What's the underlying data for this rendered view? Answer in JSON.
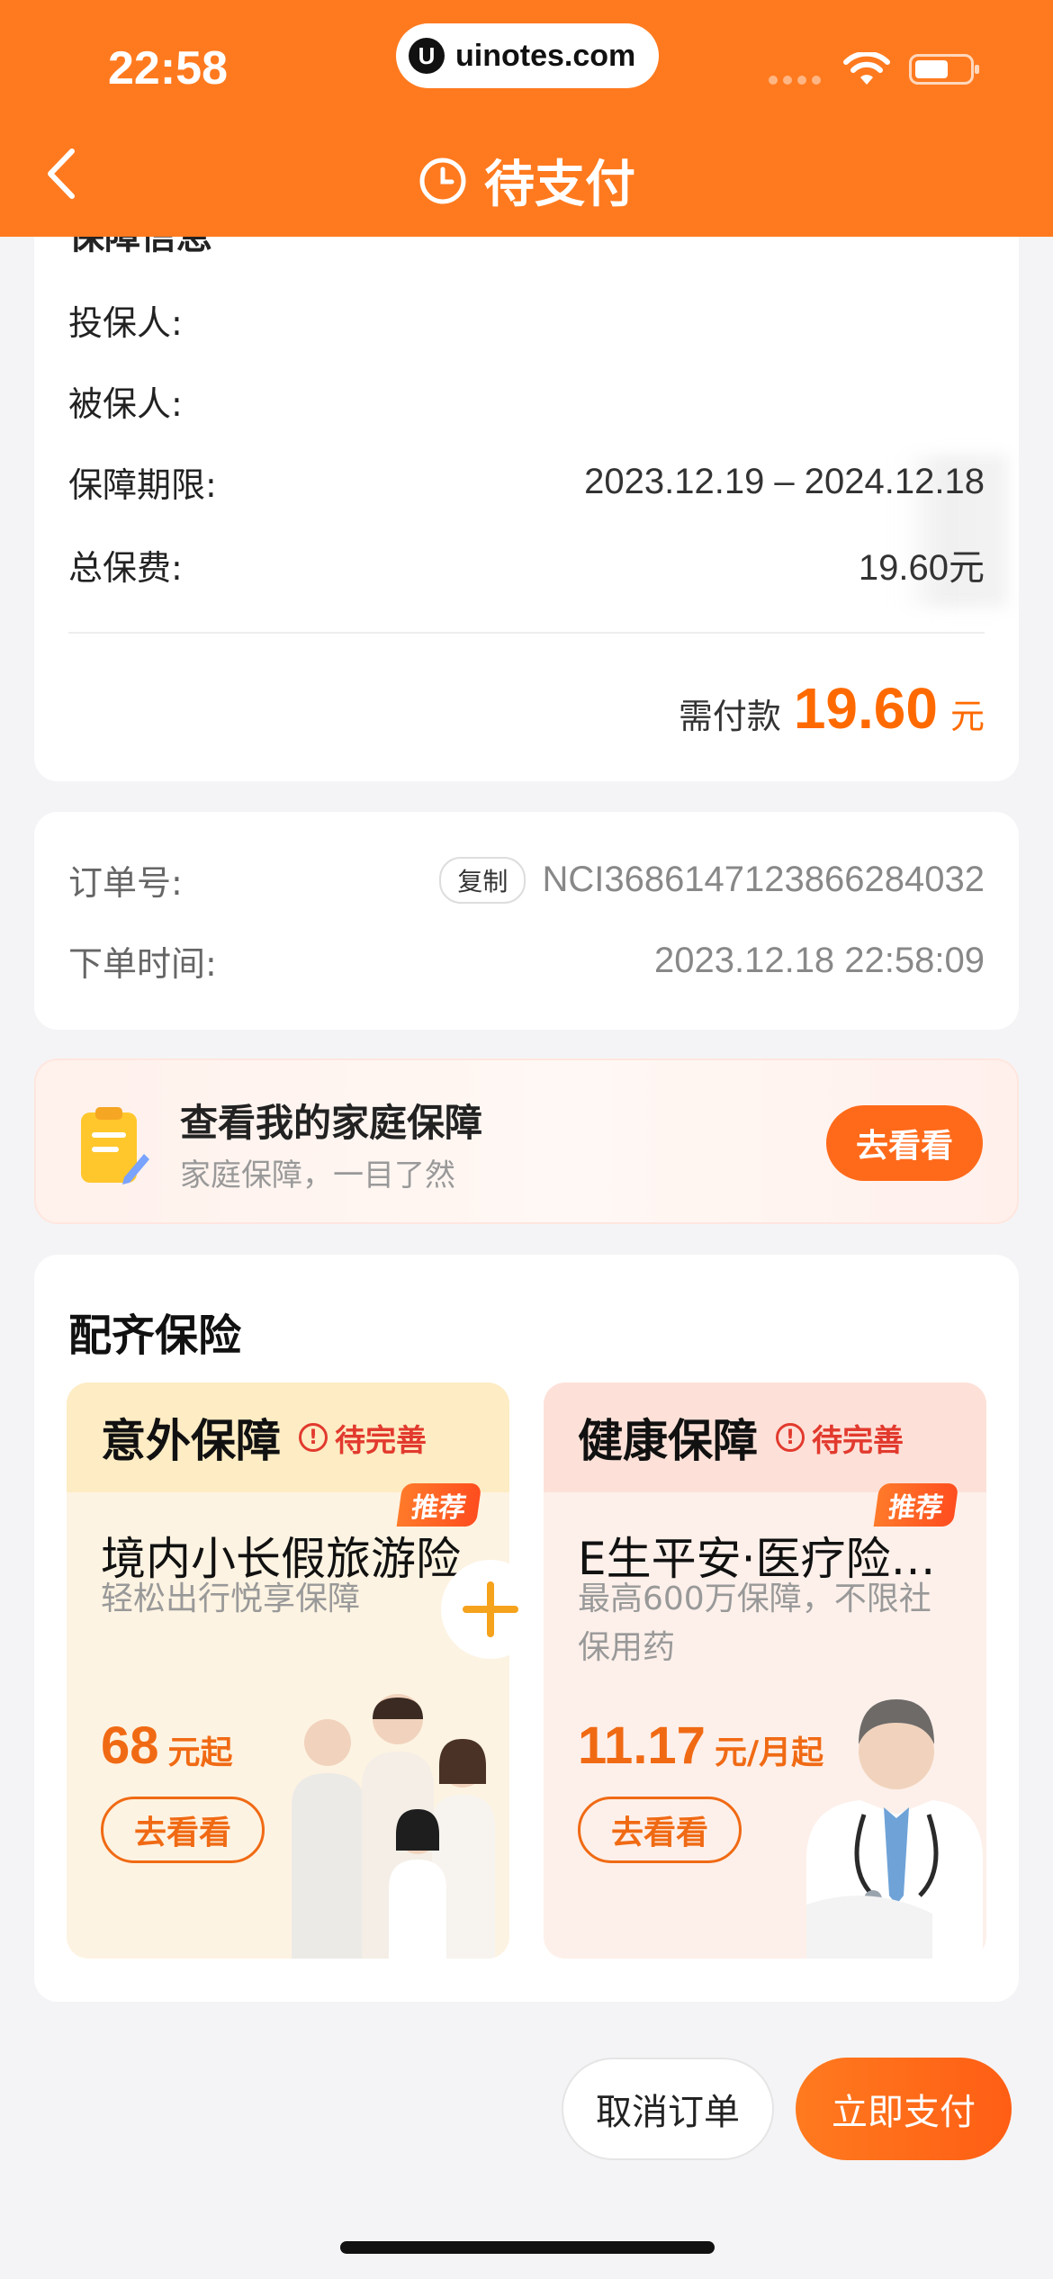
{
  "status_bar": {
    "time": "22:58",
    "url": "uinotes.com",
    "url_logo": "U"
  },
  "nav": {
    "title": "待支付",
    "back_icon": "chevron-left-icon",
    "title_icon": "clock-icon"
  },
  "coverage": {
    "section_title": "保障信息",
    "rows": [
      {
        "label": "投保人:",
        "value": ""
      },
      {
        "label": "被保人:",
        "value": ""
      },
      {
        "label": "保障期限:",
        "value": "2023.12.19 – 2024.12.18"
      },
      {
        "label": "总保费:",
        "value": "19.60元"
      }
    ],
    "payable_label": "需付款",
    "payable_amount": "19.60",
    "payable_unit": "元"
  },
  "order": {
    "number_label": "订单号:",
    "copy_label": "复制",
    "number": "NCI3686147123866284032",
    "time_label": "下单时间:",
    "time": "2023.12.18 22:58:09"
  },
  "family_banner": {
    "title": "查看我的家庭保障",
    "subtitle": "家庭保障，一目了然",
    "button": "去看看"
  },
  "match": {
    "title": "配齐保险",
    "products": [
      {
        "category": "意外保障",
        "status": "待完善",
        "badge": "推荐",
        "name": "境内小长假旅游险",
        "desc": "轻松出行悦享保障",
        "price": "68",
        "price_unit": "元起",
        "button": "去看看",
        "head_color": "#fdecc4",
        "body_color": "#fdf3e2"
      },
      {
        "category": "健康保障",
        "status": "待完善",
        "badge": "推荐",
        "name": "E生平安·医疗险…",
        "desc": "最高600万保障，不限社保用药",
        "price": "11.17",
        "price_unit": "元/月起",
        "button": "去看看",
        "head_color": "#fde1d8",
        "body_color": "#fdf0ea"
      }
    ]
  },
  "footer": {
    "cancel": "取消订单",
    "pay": "立即支付"
  },
  "colors": {
    "brand": "#ff7a1f",
    "accent": "#ff6a00",
    "warning": "#e23a2e"
  }
}
